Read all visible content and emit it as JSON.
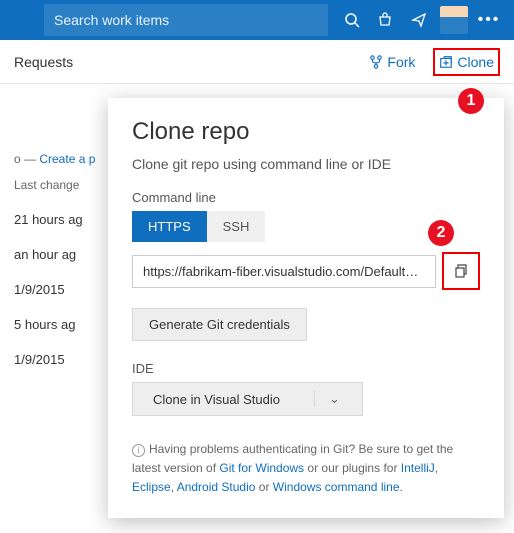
{
  "topbar": {
    "search_placeholder": "Search work items"
  },
  "subbar": {
    "title": "Requests",
    "fork": "Fork",
    "clone": "Clone"
  },
  "callouts": {
    "c1": "1",
    "c2": "2"
  },
  "crumb": {
    "prefix": "o — ",
    "link": "Create a p"
  },
  "list": {
    "header": "Last change",
    "rows": [
      "21 hours ag",
      "an hour ag",
      "1/9/2015",
      "5 hours ag",
      "1/9/2015"
    ]
  },
  "popover": {
    "title": "Clone repo",
    "subtitle": "Clone git repo using command line or IDE",
    "cmd_label": "Command line",
    "tabs": {
      "https": "HTTPS",
      "ssh": "SSH"
    },
    "url": "https://fabrikam-fiber.visualstudio.com/DefaultColl...",
    "gen_btn": "Generate Git credentials",
    "ide_label": "IDE",
    "ide_btn": "Clone in Visual Studio",
    "help_pre": "Having problems authenticating in Git? Be sure to get the latest version of ",
    "help_git": "Git for Windows",
    "help_mid": " or our plugins for ",
    "help_intellij": "IntelliJ",
    "help_eclipse": "Eclipse",
    "help_as": "Android Studio",
    "help_or": " or ",
    "help_cmd": "Windows command line",
    "help_end": "."
  }
}
